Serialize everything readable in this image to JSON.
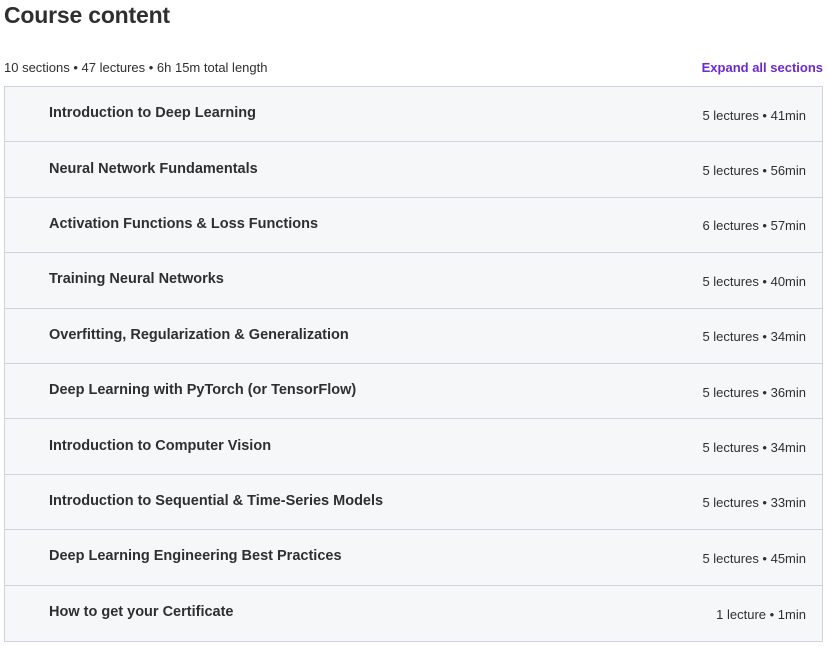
{
  "header": {
    "title": "Course content"
  },
  "summary": {
    "text": "10 sections • 47 lectures • 6h 15m total length",
    "expand_label": "Expand all sections"
  },
  "sections": [
    {
      "title": "Introduction to Deep Learning",
      "meta": "5 lectures • 41min"
    },
    {
      "title": "Neural Network Fundamentals",
      "meta": "5 lectures • 56min"
    },
    {
      "title": "Activation Functions & Loss Functions",
      "meta": "6 lectures • 57min"
    },
    {
      "title": "Training Neural Networks",
      "meta": "5 lectures • 40min"
    },
    {
      "title": "Overfitting, Regularization & Generalization",
      "meta": "5 lectures • 34min"
    },
    {
      "title": "Deep Learning with PyTorch (or TensorFlow)",
      "meta": "5 lectures • 36min"
    },
    {
      "title": "Introduction to Computer Vision",
      "meta": "5 lectures • 34min"
    },
    {
      "title": "Introduction to Sequential & Time-Series Models",
      "meta": "5 lectures • 33min"
    },
    {
      "title": "Deep Learning Engineering Best Practices",
      "meta": "5 lectures • 45min"
    },
    {
      "title": "How to get your Certificate",
      "meta": "1 lecture • 1min"
    }
  ],
  "colors": {
    "accent": "#6d28d2",
    "text": "#2d2f31",
    "row_background": "#f6f7f9",
    "border": "#d1d2e0"
  }
}
